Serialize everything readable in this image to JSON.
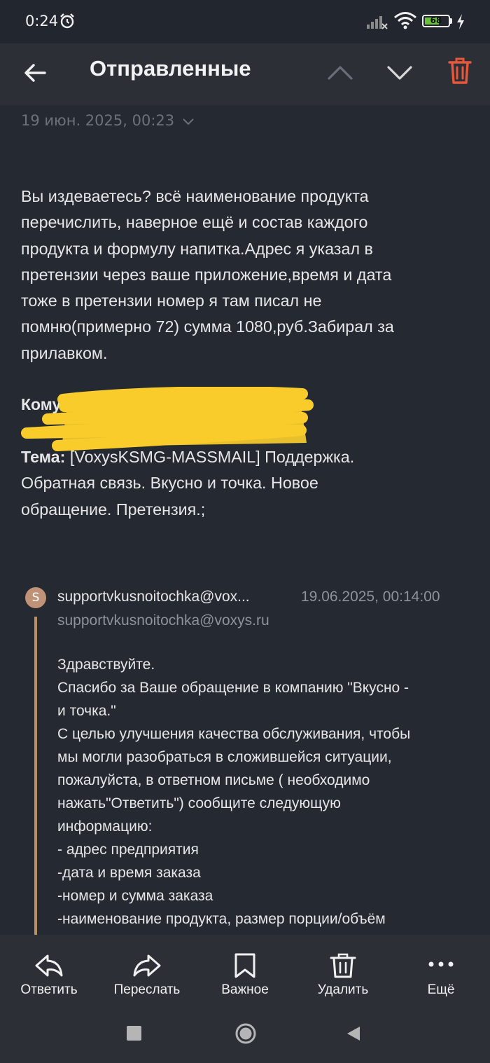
{
  "status_bar": {
    "time": "0:24",
    "battery_level": "68",
    "battery_fraction": 0.68,
    "icons": [
      "alarm-icon",
      "signal-icon",
      "wifi-icon",
      "battery-icon",
      "charging-icon"
    ]
  },
  "app_bar": {
    "title": "Отправленные",
    "icons": [
      "back-arrow-icon",
      "chevron-up-icon",
      "chevron-down-icon",
      "trash-icon"
    ]
  },
  "message": {
    "date": "19 июн. 2025, 00:23",
    "body_lines": [
      "Вы издеваетесь? всё наименование продукта",
      "перечислить, наверное ещё и состав каждого",
      "продукта и формулу напитка.Адрес я указал в",
      "претензии через ваше приложение,время и дата",
      "тоже в претензии номер я там писал не",
      "помню(примерно 72) сумма 1080,руб.Забирал за",
      "прилавком."
    ],
    "to_label": "Кому:",
    "subject_label": "Тема:",
    "subject_lines": [
      " [VoxysKSMG-MASSMAIL] Поддержка.",
      "Обратная связь. Вкусно и точка. Новое",
      "обращение. Претензия.;"
    ]
  },
  "quoted": {
    "avatar_letter": "S",
    "sender_name": "supportvkusnoitochka@vox...",
    "sender_date": "19.06.2025, 00:14:00",
    "sender_email": "supportvkusnoitochka@voxys.ru",
    "lines": [
      "Здравствуйте.",
      "Спасибо за Ваше обращение в компанию \"Вкусно -",
      "и точка.\"",
      "С целью улучшения качества обслуживания, чтобы",
      "мы могли разобраться в сложившейся ситуации,",
      "пожалуйста, в ответном письме ( необходимо",
      "нажать\"Ответить\") сообщите следующую",
      "информацию:",
      "- адрес предприятия",
      "-дата и время заказа",
      "-номер и сумма заказа",
      "-наименование продукта, размер порции/объём"
    ]
  },
  "actions": [
    {
      "label": "Ответить",
      "icon": "reply-icon"
    },
    {
      "label": "Переслать",
      "icon": "forward-icon"
    },
    {
      "label": "Важное",
      "icon": "bookmark-icon"
    },
    {
      "label": "Удалить",
      "icon": "trash-icon"
    },
    {
      "label": "Ещё",
      "icon": "more-icon"
    }
  ],
  "colors": {
    "background": "#252931",
    "bar": "#2c2f36",
    "accent_red": "#e8573b",
    "quote_line": "#b8915e",
    "redaction": "#f9cc2c"
  }
}
